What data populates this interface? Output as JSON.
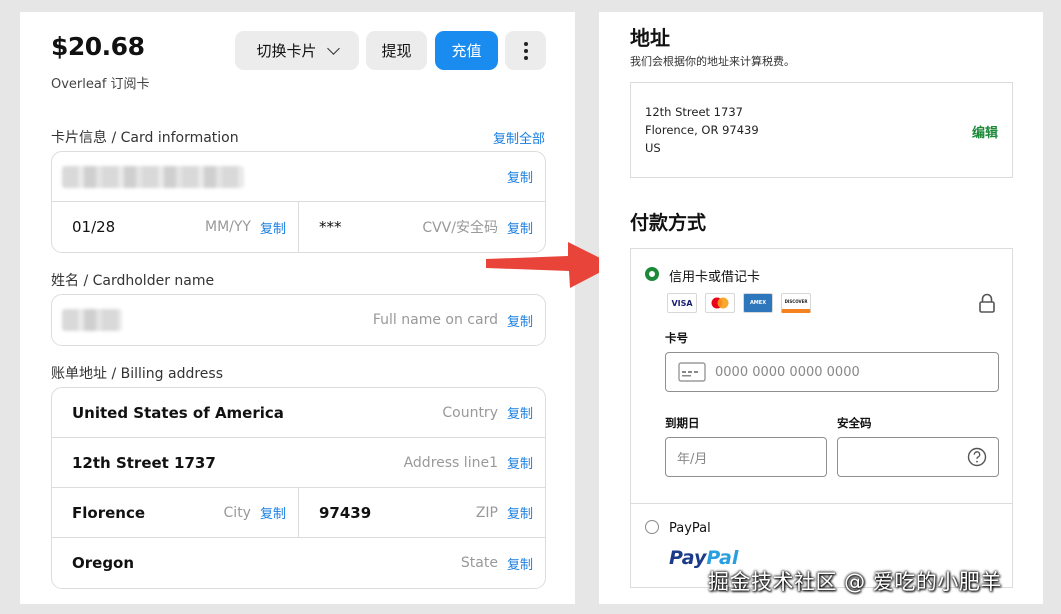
{
  "left": {
    "balance": "$20.68",
    "balance_sub": "Overleaf 订阅卡",
    "buttons": {
      "switch_card": "切换卡片",
      "withdraw": "提现",
      "topup": "充值"
    },
    "card_info": {
      "label": "卡片信息 / Card information",
      "copy_all": "复制全部",
      "expiry": "01/28",
      "expiry_hint": "MM/YY",
      "cvv": "***",
      "cvv_hint": "CVV/安全码"
    },
    "cardholder": {
      "label": "姓名 / Cardholder name",
      "hint": "Full name on card"
    },
    "billing": {
      "label": "账单地址 / Billing address",
      "country": "United States of America",
      "country_hint": "Country",
      "address": "12th Street 1737",
      "address_hint": "Address line1",
      "city": "Florence",
      "city_hint": "City",
      "zip": "97439",
      "zip_hint": "ZIP",
      "state": "Oregon",
      "state_hint": "State"
    },
    "copy_label": "复制"
  },
  "right": {
    "address_title": "地址",
    "address_sub": "我们会根据你的地址来计算税费。",
    "address_lines": [
      "12th Street 1737",
      "Florence, OR 97439",
      "US"
    ],
    "edit": "编辑",
    "payment_title": "付款方式",
    "method_card": "信用卡或借记卡",
    "card_logos": [
      "VISA",
      "MC",
      "AMEX",
      "DISCOVER"
    ],
    "card_number_label": "卡号",
    "card_number_placeholder": "0000 0000 0000 0000",
    "expiry_label": "到期日",
    "expiry_placeholder": "年/月",
    "cvc_label": "安全码",
    "method_paypal": "PayPal",
    "paypal_logo_a": "Pay",
    "paypal_logo_b": "Pal"
  },
  "watermark": "掘金技术社区 @ 爱吃的小肥羊",
  "colors": {
    "primary_blue": "#1a8cf0",
    "green": "#1d8a3a",
    "arrow_red": "#e8443a"
  }
}
